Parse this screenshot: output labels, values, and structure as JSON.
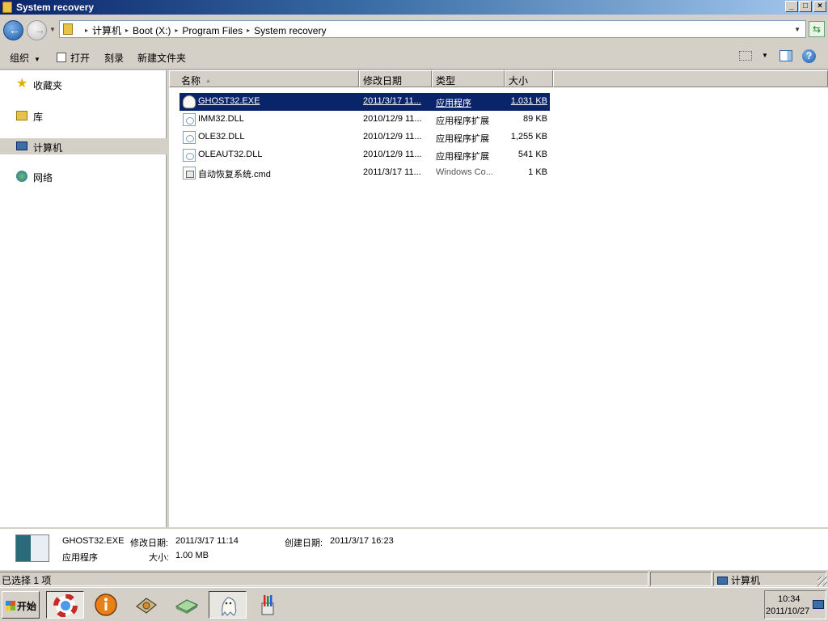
{
  "window": {
    "title": "System recovery",
    "min": "_",
    "max": "□",
    "close": "×"
  },
  "nav": {
    "back": "←",
    "forward": "→",
    "history_arrow": "▼",
    "refresh_icon": "⇆"
  },
  "address": {
    "sep": "▸",
    "crumbs": [
      "计算机",
      "Boot (X:)",
      "Program Files",
      "System recovery"
    ],
    "dropdown": "▼"
  },
  "toolbar": {
    "organize": "组织",
    "open": "打开",
    "burn": "刻录",
    "new_folder": "新建文件夹",
    "dd_arrow": "▼",
    "help": "?"
  },
  "sidebar": {
    "items": [
      {
        "label": "收藏夹",
        "icon": "star-icon",
        "glyph": "★"
      },
      {
        "label": "库",
        "icon": "library-icon"
      },
      {
        "label": "计算机",
        "icon": "computer-icon"
      },
      {
        "label": "网络",
        "icon": "network-icon"
      }
    ]
  },
  "columns": {
    "name": "名称",
    "date": "修改日期",
    "type": "类型",
    "size": "大小",
    "sort_arrow": "▲"
  },
  "files": [
    {
      "name": "GHOST32.EXE",
      "date": "2011/3/17 11...",
      "type": "应用程序",
      "size": "1,031 KB",
      "icon": "ghost-app-icon"
    },
    {
      "name": "IMM32.DLL",
      "date": "2010/12/9 11...",
      "type": "应用程序扩展",
      "size": "89 KB",
      "icon": "dll-file-icon"
    },
    {
      "name": "OLE32.DLL",
      "date": "2010/12/9 11...",
      "type": "应用程序扩展",
      "size": "1,255 KB",
      "icon": "dll-file-icon"
    },
    {
      "name": "OLEAUT32.DLL",
      "date": "2010/12/9 11...",
      "type": "应用程序扩展",
      "size": "541 KB",
      "icon": "dll-file-icon"
    },
    {
      "name": "自动恢复系统.cmd",
      "date": "2011/3/17 11...",
      "type": "Windows Co...",
      "size": "1 KB",
      "icon": "cmd-file-icon"
    }
  ],
  "details": {
    "filename": "GHOST32.EXE",
    "modified_label": "修改日期:",
    "modified": "2011/3/17 11:14",
    "created_label": "创建日期:",
    "created": "2011/3/17 16:23",
    "type": "应用程序",
    "size_label": "大小:",
    "size": "1.00 MB"
  },
  "status": {
    "selected": "已选择 1 项",
    "location": "计算机"
  },
  "taskbar": {
    "start": "开始",
    "apps": [
      "rescue-ring-icon",
      "info-icon",
      "disk-utility-icon",
      "disk-icon",
      "ghost-icon",
      "paint-tools-icon"
    ],
    "time": "10:34",
    "date": "2011/10/27"
  }
}
